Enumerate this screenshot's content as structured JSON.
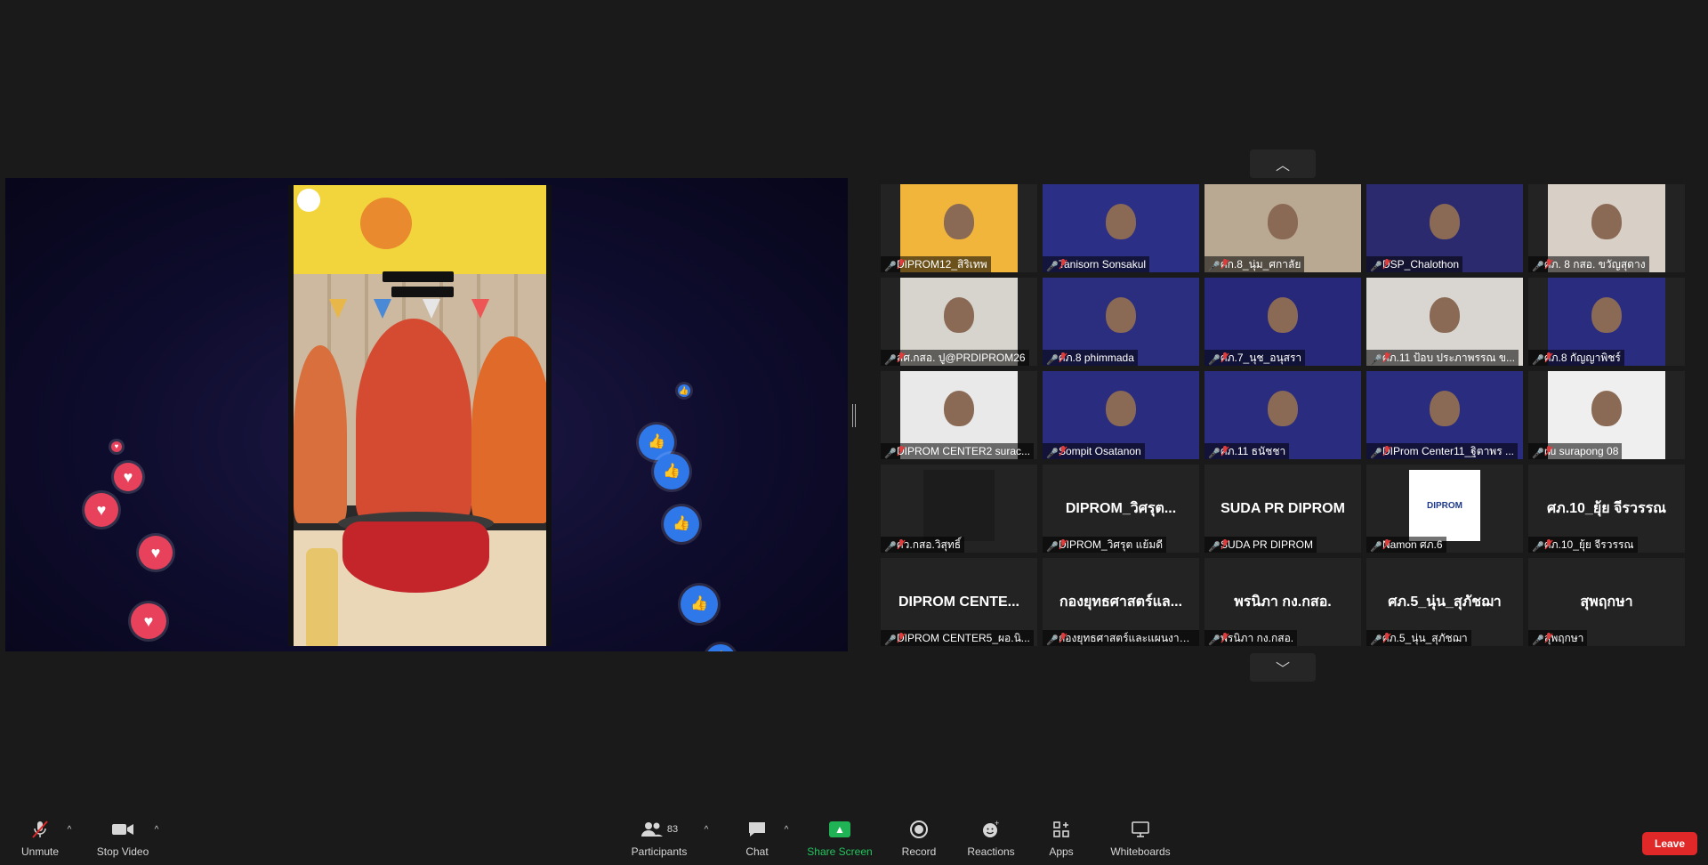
{
  "gallery": {
    "tiles": [
      {
        "name": "DIPROM12_สิริเทพ",
        "mode": "video",
        "bg": "#f0b53a"
      },
      {
        "name": "Tanisorn Sonsakul",
        "mode": "video",
        "bg": "#2c2f86"
      },
      {
        "name": "ศก.8_นุ่ม_ศกาลัย",
        "mode": "video",
        "bg": "#b9a993"
      },
      {
        "name": "DSP_Chalothon",
        "mode": "video",
        "bg": "#2b2a6e"
      },
      {
        "name": "ศภ. 8 กสอ. ขวัญสุดาง",
        "mode": "video",
        "bg": "#d8cfc7"
      },
      {
        "name": "สศ.กสอ. ปู@PRDIPROM26",
        "mode": "video",
        "bg": "#d7d3cd"
      },
      {
        "name": "ศภ.8 phimmada",
        "mode": "video",
        "bg": "#2b2d7e"
      },
      {
        "name": "ศภ.7_นุช_อนุสรา",
        "mode": "video",
        "bg": "#27287a"
      },
      {
        "name": "ศภ.11 ป้อบ ประภาพรรณ ข...",
        "mode": "video",
        "bg": "#d9d5d0"
      },
      {
        "name": "ศภ.8 กัญญาพิชร์",
        "mode": "video",
        "bg": "#2a2c80"
      },
      {
        "name": "DIPROM CENTER2 surac...",
        "mode": "video",
        "bg": "#e9e9e9"
      },
      {
        "name": "Sompit Osatanon",
        "mode": "video",
        "bg": "#2a2c7f"
      },
      {
        "name": "ศภ.11 ธนัชชา",
        "mode": "video",
        "bg": "#2a2c7f"
      },
      {
        "name": "DIProm Center11_ฐิตาพร ...",
        "mode": "video",
        "bg": "#2a2c7f"
      },
      {
        "name": "nu surapong 08",
        "mode": "video",
        "bg": "#efefef"
      },
      {
        "name": "ศว.กสอ.วิสุทธิ์",
        "mode": "avatar",
        "bg": "#1c1c1c",
        "display": ""
      },
      {
        "name": "DIPROM_วิศรุต แย้มดี",
        "mode": "name",
        "display": "DIPROM_วิศรุต..."
      },
      {
        "name": "SUDA PR DIPROM",
        "mode": "name",
        "display": "SUDA PR DIPROM"
      },
      {
        "name": "Namon ศภ.6",
        "mode": "avatar",
        "bg": "#ffffff",
        "display": "DIPROM"
      },
      {
        "name": "ศภ.10_ยุ้ย จีรวรรณ",
        "mode": "name",
        "display": "ศภ.10_ยุ้ย จีรวรรณ"
      },
      {
        "name": "DIPROM CENTER5_ผอ.นิ...",
        "mode": "name",
        "display": "DIPROM  CENTE..."
      },
      {
        "name": "กองยุทธศาสตร์และแผนงาน ...",
        "mode": "name",
        "display": "กองยุทธศาสตร์แล..."
      },
      {
        "name": "พรนิภา กง.กสอ.",
        "mode": "name",
        "display": "พรนิภา กง.กสอ."
      },
      {
        "name": "ศภ.5_นุ่น_สุภัชฌา",
        "mode": "name",
        "display": "ศภ.5_นุ่น_สุภัชฌา"
      },
      {
        "name": "สุพฤกษา",
        "mode": "name",
        "display": "สุพฤกษา"
      }
    ]
  },
  "share": {
    "banner_color": "#f2d53c",
    "accent": "#c4252a"
  },
  "toolbar": {
    "unmute": "Unmute",
    "stop_video": "Stop Video",
    "participants": "Participants",
    "participants_count": "83",
    "chat": "Chat",
    "share_screen": "Share Screen",
    "record": "Record",
    "reactions": "Reactions",
    "apps": "Apps",
    "whiteboards": "Whiteboards",
    "leave": "Leave"
  },
  "colors": {
    "share_green": "#23c55e",
    "leave_red": "#e02828",
    "heart": "#e8415c",
    "like": "#2f78ea"
  }
}
